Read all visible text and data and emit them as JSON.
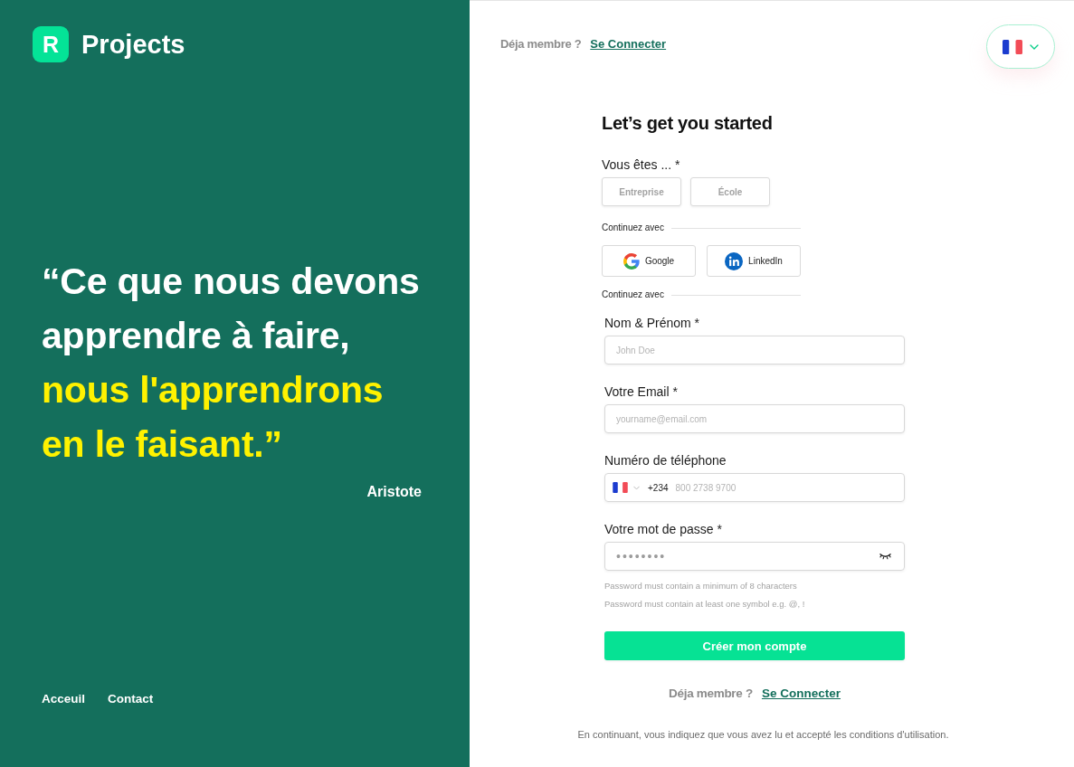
{
  "brand": {
    "logo_letter": "R",
    "name": "Projects"
  },
  "quote": {
    "parts": [
      {
        "text": "“Ce que nous devons apprendre à faire,",
        "highlighted": false
      },
      {
        "text": "nous l'apprendrons en le faisant.”",
        "highlighted": true
      }
    ],
    "author": "Aristote"
  },
  "footer_links": [
    "Acceuil",
    "Contact"
  ],
  "top_bar": {
    "prompt": "Déja membre ?",
    "link": "Se Connecter"
  },
  "form": {
    "title": "Let’s get you started",
    "account_type": {
      "label": "Vous êtes ... *",
      "options": [
        {
          "label": "Entreprise",
          "selected": false
        },
        {
          "label": "École",
          "selected": false
        }
      ]
    },
    "social_divider": "Continuez avec",
    "social_buttons": [
      {
        "kind": "google",
        "label": "Google"
      },
      {
        "kind": "linkedin",
        "label": "LinkedIn"
      }
    ],
    "fields_divider": "Continuez avec",
    "fields": [
      {
        "kind": "text",
        "label": "Nom & Prénom *",
        "placeholder": "John Doe"
      },
      {
        "kind": "text",
        "label": "Votre Email *",
        "placeholder": "yourname@email.com"
      },
      {
        "kind": "phone",
        "label": "Numéro de téléphone",
        "dial_code": "+234",
        "placeholder": "800 2738 9700"
      },
      {
        "kind": "password",
        "label": "Votre mot de passe *",
        "value": "••••••••",
        "hints": [
          "Password must contain a minimum of 8 characters",
          "Password must contain at least one symbol e.g. @, !"
        ]
      }
    ],
    "submit": "Créer mon compte",
    "login_prompt": {
      "prompt": "Déja membre ?",
      "link": "Se Connecter"
    }
  },
  "terms": "En continuant, vous indiquez que vous avez lu et accepté les conditions d'utilisation."
}
